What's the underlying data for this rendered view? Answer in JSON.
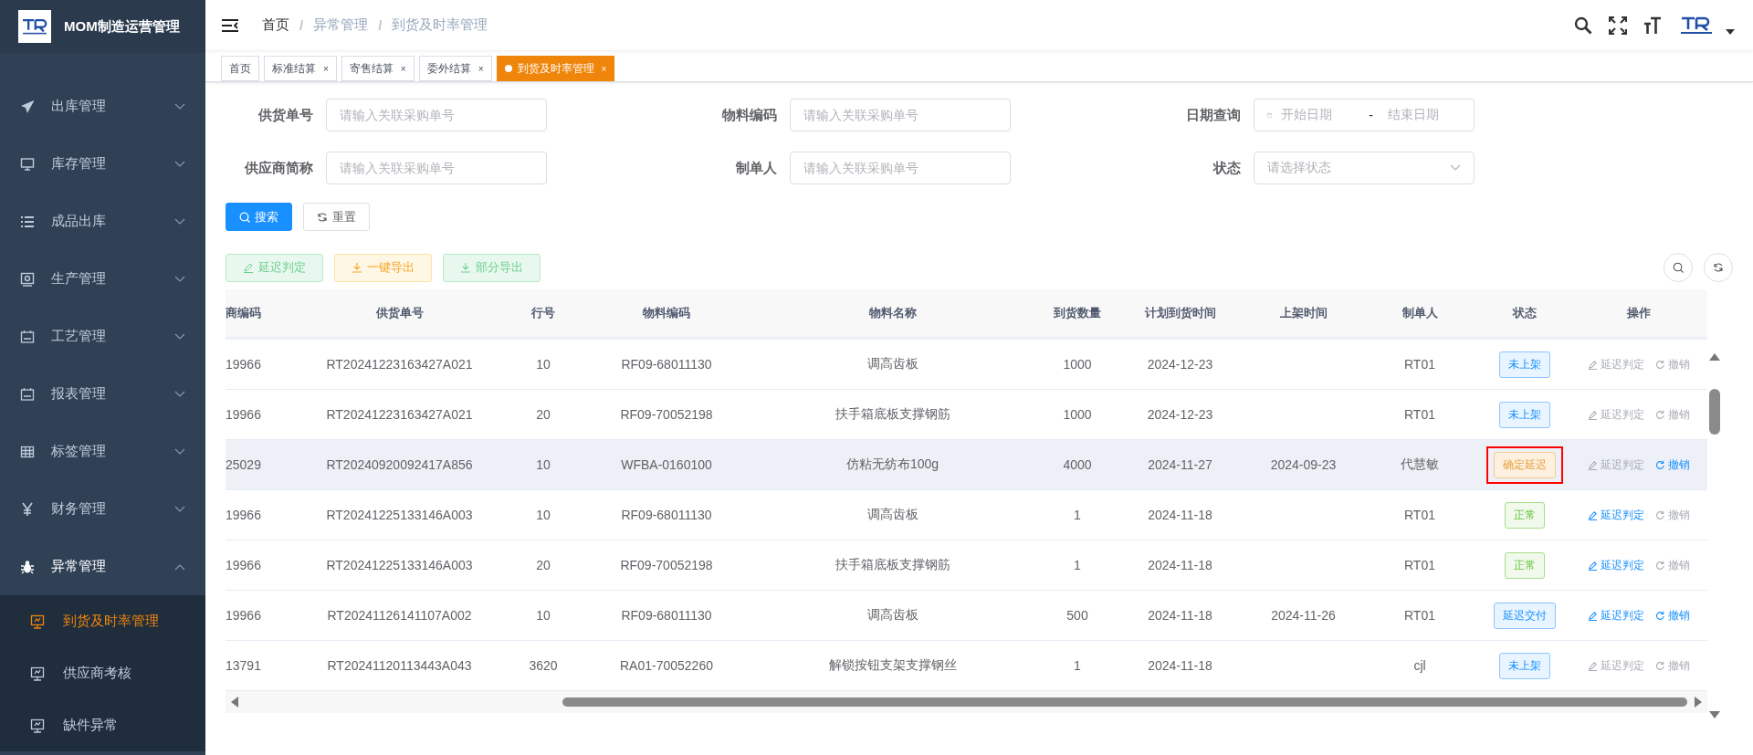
{
  "app": {
    "title": "MOM制造运营管理"
  },
  "sidebar": {
    "items": [
      {
        "label": "出库管理",
        "expanded": false
      },
      {
        "label": "库存管理",
        "expanded": false
      },
      {
        "label": "成品出库",
        "expanded": false
      },
      {
        "label": "生产管理",
        "expanded": false
      },
      {
        "label": "工艺管理",
        "expanded": false
      },
      {
        "label": "报表管理",
        "expanded": false
      },
      {
        "label": "标签管理",
        "expanded": false
      },
      {
        "label": "财务管理",
        "expanded": false
      },
      {
        "label": "异常管理",
        "expanded": true,
        "children": [
          {
            "label": "到货及时率管理",
            "selected": true
          },
          {
            "label": "供应商考核",
            "selected": false
          },
          {
            "label": "缺件异常",
            "selected": false
          }
        ]
      }
    ]
  },
  "breadcrumb": [
    "首页",
    "异常管理",
    "到货及时率管理"
  ],
  "breadcrumb_separator": "/",
  "tabs": [
    {
      "label": "首页",
      "selected": false,
      "closable": false
    },
    {
      "label": "标准结算",
      "selected": false,
      "closable": true
    },
    {
      "label": "寄售结算",
      "selected": false,
      "closable": true
    },
    {
      "label": "委外结算",
      "selected": false,
      "closable": true
    },
    {
      "label": "到货及时率管理",
      "selected": true,
      "closable": true
    }
  ],
  "tab_close": "×",
  "filters": [
    {
      "label": "供货单号",
      "kind": "text",
      "placeholder": "请输入关联采购单号"
    },
    {
      "label": "物料编码",
      "kind": "text",
      "placeholder": "请输入关联采购单号"
    },
    {
      "label": "日期查询",
      "kind": "daterange",
      "start_placeholder": "开始日期",
      "separator": "-",
      "end_placeholder": "结束日期"
    },
    {
      "label": "供应商简称",
      "kind": "text",
      "placeholder": "请输入关联采购单号"
    },
    {
      "label": "制单人",
      "kind": "text",
      "placeholder": "请输入关联采购单号"
    },
    {
      "label": "状态",
      "kind": "select",
      "placeholder": "请选择状态"
    }
  ],
  "search_buttons": [
    {
      "label": "搜索",
      "kind": "primary"
    },
    {
      "label": "重置",
      "kind": "plain"
    }
  ],
  "action_buttons": [
    {
      "label": "延迟判定",
      "kind": "success"
    },
    {
      "label": "一键导出",
      "kind": "warning"
    },
    {
      "label": "部分导出",
      "kind": "success"
    }
  ],
  "table": {
    "columns": [
      "商编码",
      "供货单号",
      "行号",
      "物料编码",
      "物料名称",
      "到货数量",
      "计划到货时间",
      "上架时间",
      "制单人",
      "状态",
      "操作"
    ],
    "rows": [
      {
        "selected": false,
        "cells": [
          "19966",
          "RT20241223163427A021",
          "10",
          "RF09-68011130",
          "调高齿板",
          "1000",
          "2024-12-23",
          "",
          "RT01"
        ],
        "status": {
          "label": "未上架",
          "kind": "info",
          "highlighted": false
        },
        "actions": [
          {
            "label": "延迟判定",
            "disabled": true
          },
          {
            "label": "撤销",
            "disabled": true
          }
        ]
      },
      {
        "selected": false,
        "cells": [
          "19966",
          "RT20241223163427A021",
          "20",
          "RF09-70052198",
          "扶手箱底板支撑钢筋",
          "1000",
          "2024-12-23",
          "",
          "RT01"
        ],
        "status": {
          "label": "未上架",
          "kind": "info",
          "highlighted": false
        },
        "actions": [
          {
            "label": "延迟判定",
            "disabled": true
          },
          {
            "label": "撤销",
            "disabled": true
          }
        ]
      },
      {
        "selected": true,
        "cells": [
          "25029",
          "RT20240920092417A856",
          "10",
          "WFBA-0160100",
          "仿粘无纺布100g",
          "4000",
          "2024-11-27",
          "2024-09-23",
          "代慧敏"
        ],
        "status": {
          "label": "确定延迟",
          "kind": "warning",
          "highlighted": true
        },
        "actions": [
          {
            "label": "延迟判定",
            "disabled": true
          },
          {
            "label": "撤销",
            "disabled": false
          }
        ]
      },
      {
        "selected": false,
        "cells": [
          "19966",
          "RT20241225133146A003",
          "10",
          "RF09-68011130",
          "调高齿板",
          "1",
          "2024-11-18",
          "",
          "RT01"
        ],
        "status": {
          "label": "正常",
          "kind": "success",
          "highlighted": false
        },
        "actions": [
          {
            "label": "延迟判定",
            "disabled": false
          },
          {
            "label": "撤销",
            "disabled": true
          }
        ]
      },
      {
        "selected": false,
        "cells": [
          "19966",
          "RT20241225133146A003",
          "20",
          "RF09-70052198",
          "扶手箱底板支撑钢筋",
          "1",
          "2024-11-18",
          "",
          "RT01"
        ],
        "status": {
          "label": "正常",
          "kind": "success",
          "highlighted": false
        },
        "actions": [
          {
            "label": "延迟判定",
            "disabled": false
          },
          {
            "label": "撤销",
            "disabled": true
          }
        ]
      },
      {
        "selected": false,
        "cells": [
          "19966",
          "RT20241126141107A002",
          "10",
          "RF09-68011130",
          "调高齿板",
          "500",
          "2024-11-18",
          "2024-11-26",
          "RT01"
        ],
        "status": {
          "label": "延迟交付",
          "kind": "primary",
          "highlighted": false
        },
        "actions": [
          {
            "label": "延迟判定",
            "disabled": false
          },
          {
            "label": "撤销",
            "disabled": false
          }
        ]
      },
      {
        "selected": false,
        "cells": [
          "13791",
          "RT20241120113443A043",
          "3620",
          "RA01-70052260",
          "解锁按钮支架支撑钢丝",
          "1",
          "2024-11-18",
          "",
          "cjl"
        ],
        "status": {
          "label": "未上架",
          "kind": "info",
          "highlighted": false
        },
        "actions": [
          {
            "label": "延迟判定",
            "disabled": true
          },
          {
            "label": "撤销",
            "disabled": true
          }
        ]
      }
    ]
  }
}
